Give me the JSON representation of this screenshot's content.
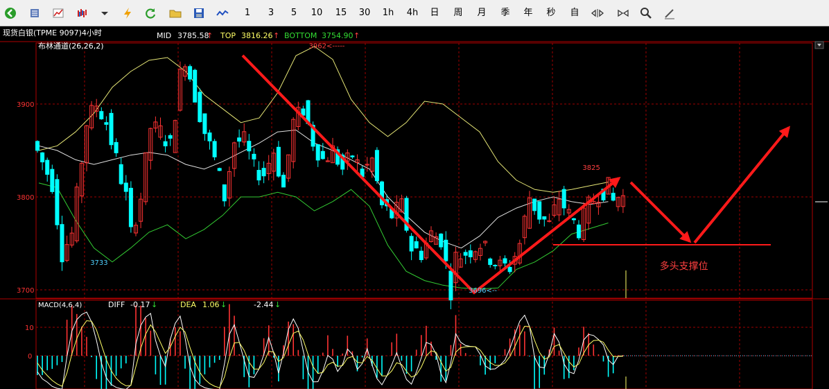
{
  "toolbar": {
    "icons": [
      "back-icon",
      "list-icon",
      "line-chart-icon",
      "bar-chart-icon",
      "dropdown-arrow-icon",
      "lightning-icon",
      "refresh-icon",
      "folder-icon",
      "save-icon",
      "wave-icon"
    ],
    "periods": [
      "1",
      "3",
      "5",
      "10",
      "15",
      "30",
      "1h",
      "4h",
      "日",
      "周",
      "月",
      "季",
      "年",
      "秒",
      "自"
    ],
    "tools": [
      "zoom-out-icon",
      "zoom-in-icon",
      "search-icon",
      "draw-icon"
    ]
  },
  "header": {
    "symbol": "现货白银(TPME 9097)4小时",
    "mid_label": "MID",
    "mid_value": "3785.58",
    "top_label": "TOP",
    "top_value": "3816.26",
    "bottom_label": "BOTTOM",
    "bottom_value": "3754.90",
    "arrow": "↑"
  },
  "colors": {
    "bull": "#ff3333",
    "bear": "#00ffff",
    "upper": "#e6e676",
    "mid": "#e0e0e0",
    "lower": "#33cc33",
    "grid": "#a00000",
    "axis": "#b00000",
    "macd_text": "#ffffff"
  },
  "chart_data": [
    {
      "type": "candlestick",
      "title": "布林通道(26,26,2)",
      "ylim": [
        3680,
        3975
      ],
      "yticks": [
        3700,
        3800,
        3900
      ],
      "bands": {
        "upper": [
          3850,
          3855,
          3870,
          3890,
          3918,
          3935,
          3947,
          3950,
          3935,
          3910,
          3895,
          3880,
          3885,
          3912,
          3952,
          3962,
          3948,
          3905,
          3880,
          3865,
          3880,
          3903,
          3900,
          3885,
          3870,
          3838,
          3818,
          3808,
          3805,
          3808,
          3812,
          3816
        ],
        "mid": [
          3855,
          3850,
          3840,
          3835,
          3840,
          3845,
          3848,
          3845,
          3835,
          3830,
          3838,
          3848,
          3858,
          3870,
          3872,
          3858,
          3850,
          3840,
          3830,
          3800,
          3780,
          3762,
          3752,
          3745,
          3758,
          3778,
          3788,
          3795,
          3800,
          3795,
          3792,
          3795
        ],
        "lower": [
          3815,
          3810,
          3775,
          3745,
          3730,
          3745,
          3762,
          3770,
          3755,
          3765,
          3780,
          3800,
          3800,
          3805,
          3800,
          3785,
          3795,
          3808,
          3790,
          3748,
          3720,
          3710,
          3705,
          3702,
          3701,
          3702,
          3722,
          3730,
          3742,
          3760,
          3766,
          3772
        ]
      },
      "annotations": [
        {
          "text": "3962<-----",
          "x": 14.7,
          "y": 3960
        },
        {
          "text": "3733",
          "x": 2.8,
          "y": 3727
        },
        {
          "text": "3696<--",
          "x": 23.4,
          "y": 3697
        },
        {
          "text": "3825",
          "x": 29.6,
          "y": 3829
        },
        {
          "text": "多头支撑位",
          "x": 33.8,
          "y": 3722
        }
      ]
    },
    {
      "type": "macd",
      "title": "MACD(4,6,4)",
      "diff_label": "DIFF",
      "diff_value": "-0.17",
      "dea_label": "DEA",
      "dea_value": "1.06",
      "hist_value": "-2.44",
      "arrow": "↓",
      "ylim": [
        -12,
        18
      ],
      "yticks": [
        0,
        10
      ]
    }
  ]
}
